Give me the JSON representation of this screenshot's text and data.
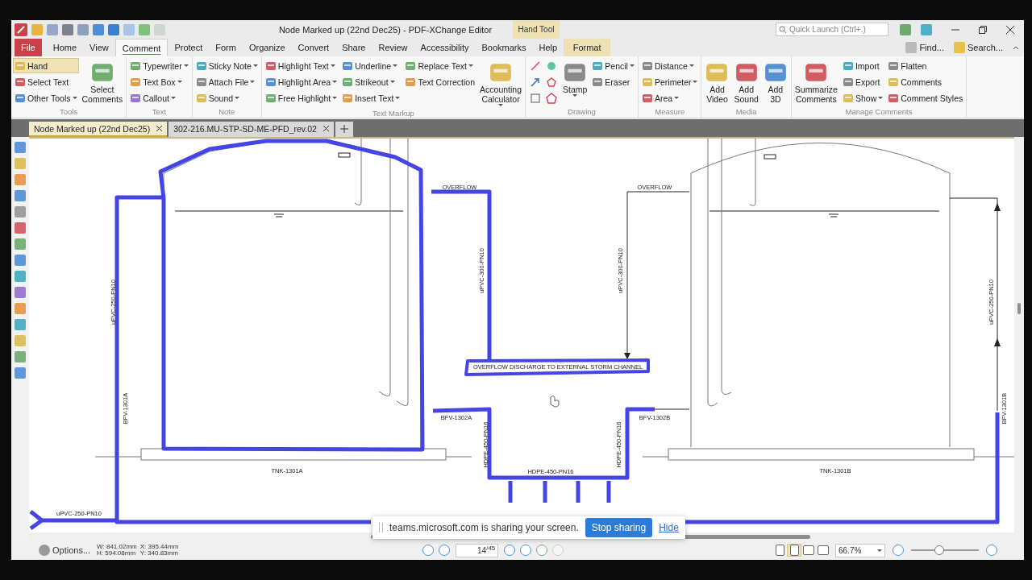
{
  "title_bar": {
    "title": "Node Marked up (22nd Dec25) - PDF-XChange Editor",
    "context_label": "Hand Tool",
    "quick_launch": {
      "placeholder": "Quick Launch (Ctrl+.)"
    }
  },
  "menu_tabs": [
    {
      "label": "File",
      "kind": "file",
      "selected": false
    },
    {
      "label": "Home",
      "kind": "normal",
      "selected": false
    },
    {
      "label": "View",
      "kind": "normal",
      "selected": false
    },
    {
      "label": "Comment",
      "kind": "normal",
      "selected": true
    },
    {
      "label": "Protect",
      "kind": "normal",
      "selected": false
    },
    {
      "label": "Form",
      "kind": "normal",
      "selected": false
    },
    {
      "label": "Organize",
      "kind": "normal",
      "selected": false
    },
    {
      "label": "Convert",
      "kind": "normal",
      "selected": false
    },
    {
      "label": "Share",
      "kind": "normal",
      "selected": false
    },
    {
      "label": "Review",
      "kind": "normal",
      "selected": false
    },
    {
      "label": "Accessibility",
      "kind": "normal",
      "selected": false
    },
    {
      "label": "Bookmarks",
      "kind": "normal",
      "selected": false
    },
    {
      "label": "Help",
      "kind": "normal",
      "selected": false
    },
    {
      "label": "Format",
      "kind": "contextual",
      "selected": false
    }
  ],
  "menu_right": [
    "Find...",
    "Search..."
  ],
  "ribbon": [
    {
      "label": "Tools",
      "columns": [
        {
          "kind": "stack",
          "items": [
            {
              "label": "Hand",
              "selected": true,
              "dropdown": false
            },
            {
              "label": "Select Text",
              "selected": false,
              "dropdown": false
            },
            {
              "label": "Other Tools",
              "selected": false,
              "dropdown": true
            }
          ]
        },
        {
          "kind": "large",
          "items": [
            {
              "label": "Select Comments",
              "selected": false,
              "dropdown": false
            }
          ]
        }
      ]
    },
    {
      "label": "Text",
      "columns": [
        {
          "kind": "stack",
          "items": [
            {
              "label": "Typewriter",
              "selected": false,
              "dropdown": true
            },
            {
              "label": "Text Box",
              "selected": false,
              "dropdown": true
            },
            {
              "label": "Callout",
              "selected": false,
              "dropdown": true
            }
          ]
        }
      ]
    },
    {
      "label": "Note",
      "columns": [
        {
          "kind": "stack",
          "items": [
            {
              "label": "Sticky Note",
              "selected": false,
              "dropdown": true
            },
            {
              "label": "Attach File",
              "selected": false,
              "dropdown": true
            },
            {
              "label": "Sound",
              "selected": false,
              "dropdown": true
            }
          ]
        }
      ]
    },
    {
      "label": "Text Markup",
      "columns": [
        {
          "kind": "stack",
          "items": [
            {
              "label": "Highlight Text",
              "selected": false,
              "dropdown": true
            },
            {
              "label": "Highlight Area",
              "selected": false,
              "dropdown": true
            },
            {
              "label": "Free Highlight",
              "selected": false,
              "dropdown": true
            }
          ]
        },
        {
          "kind": "stack",
          "items": [
            {
              "label": "Underline",
              "selected": false,
              "dropdown": true
            },
            {
              "label": "Strikeout",
              "selected": false,
              "dropdown": true
            },
            {
              "label": "Insert Text",
              "selected": false,
              "dropdown": true
            }
          ]
        },
        {
          "kind": "stack",
          "items": [
            {
              "label": "Replace Text",
              "selected": false,
              "dropdown": true
            },
            {
              "label": "Text Correction",
              "selected": false,
              "dropdown": false
            }
          ]
        },
        {
          "kind": "large",
          "items": [
            {
              "label": "Accounting Calculator",
              "selected": false,
              "dropdown": true
            }
          ]
        }
      ]
    },
    {
      "label": "Drawing",
      "columns": [
        {
          "kind": "shapes"
        },
        {
          "kind": "large",
          "items": [
            {
              "label": "Stamp",
              "selected": false,
              "dropdown": true
            }
          ]
        },
        {
          "kind": "stack",
          "items": [
            {
              "label": "Pencil",
              "selected": false,
              "dropdown": true
            },
            {
              "label": "Eraser",
              "selected": false,
              "dropdown": false
            }
          ]
        }
      ]
    },
    {
      "label": "Measure",
      "columns": [
        {
          "kind": "stack",
          "items": [
            {
              "label": "Distance",
              "selected": false,
              "dropdown": true
            },
            {
              "label": "Perimeter",
              "selected": false,
              "dropdown": true
            },
            {
              "label": "Area",
              "selected": false,
              "dropdown": true
            }
          ]
        }
      ]
    },
    {
      "label": "Media",
      "columns": [
        {
          "kind": "large",
          "items": [
            {
              "label": "Add Video",
              "selected": false,
              "dropdown": false
            }
          ]
        },
        {
          "kind": "large",
          "items": [
            {
              "label": "Add Sound",
              "selected": false,
              "dropdown": false
            }
          ]
        },
        {
          "kind": "large",
          "items": [
            {
              "label": "Add 3D",
              "selected": false,
              "dropdown": false
            }
          ]
        }
      ]
    },
    {
      "label": "Manage Comments",
      "columns": [
        {
          "kind": "large",
          "items": [
            {
              "label": "Summarize Comments",
              "selected": false,
              "dropdown": false
            }
          ]
        },
        {
          "kind": "stack",
          "items": [
            {
              "label": "Import",
              "selected": false,
              "dropdown": false
            },
            {
              "label": "Export",
              "selected": false,
              "dropdown": false
            },
            {
              "label": "Show",
              "selected": false,
              "dropdown": true
            }
          ]
        },
        {
          "kind": "stack",
          "items": [
            {
              "label": "Flatten",
              "selected": false,
              "dropdown": false
            },
            {
              "label": "Comments",
              "selected": false,
              "dropdown": false
            },
            {
              "label": "Comment Styles",
              "selected": false,
              "dropdown": false
            }
          ]
        }
      ]
    }
  ],
  "doc_tabs": [
    {
      "label": "Node Marked up (22nd Dec25)",
      "selected": true
    },
    {
      "label": "302-216.MU-STP-SD-ME-PFD_rev.02",
      "selected": false
    }
  ],
  "drawing": {
    "labels": [
      {
        "text": "OVERFLOW",
        "vertical": false
      },
      {
        "text": "OVERFLOW",
        "vertical": false
      },
      {
        "text": "uPVC-300-PN10",
        "vertical": true
      },
      {
        "text": "uPVC-300-PN10",
        "vertical": true
      },
      {
        "text": "uPVC-250-PN10",
        "vertical": true
      },
      {
        "text": "uPVC-250-PN10",
        "vertical": true
      },
      {
        "text": "OVERFLOW DISCHARGE TO EXTERNAL STORM CHANNEL",
        "vertical": false
      },
      {
        "text": "BFV-1301A",
        "vertical": true
      },
      {
        "text": "BFV-1302A",
        "vertical": false
      },
      {
        "text": "BFV-1302B",
        "vertical": false
      },
      {
        "text": "BFV-1301B",
        "vertical": true
      },
      {
        "text": "HDPE-450-PN16",
        "vertical": true
      },
      {
        "text": "HDPE-450-PN16",
        "vertical": true
      },
      {
        "text": "TNK-1301A",
        "vertical": false
      },
      {
        "text": "HDPE-450-PN16",
        "vertical": false
      },
      {
        "text": "TNK-1301B",
        "vertical": false
      },
      {
        "text": "uPVC-250-PN10",
        "vertical": false
      }
    ]
  },
  "screen_share": {
    "message": "teams.microsoft.com is sharing your screen.",
    "stop_button": "Stop sharing",
    "hide_link": "Hide"
  },
  "status_bar": {
    "options": "Options...",
    "width": "W: 841.02mm",
    "height": "H: 594.08mm",
    "x": "X: 395.44mm",
    "y": "Y: 340.83mm",
    "page": "14",
    "page_count": "/45",
    "zoom": "66.7%",
    "zoom_slider": {
      "level": 0.42
    }
  }
}
